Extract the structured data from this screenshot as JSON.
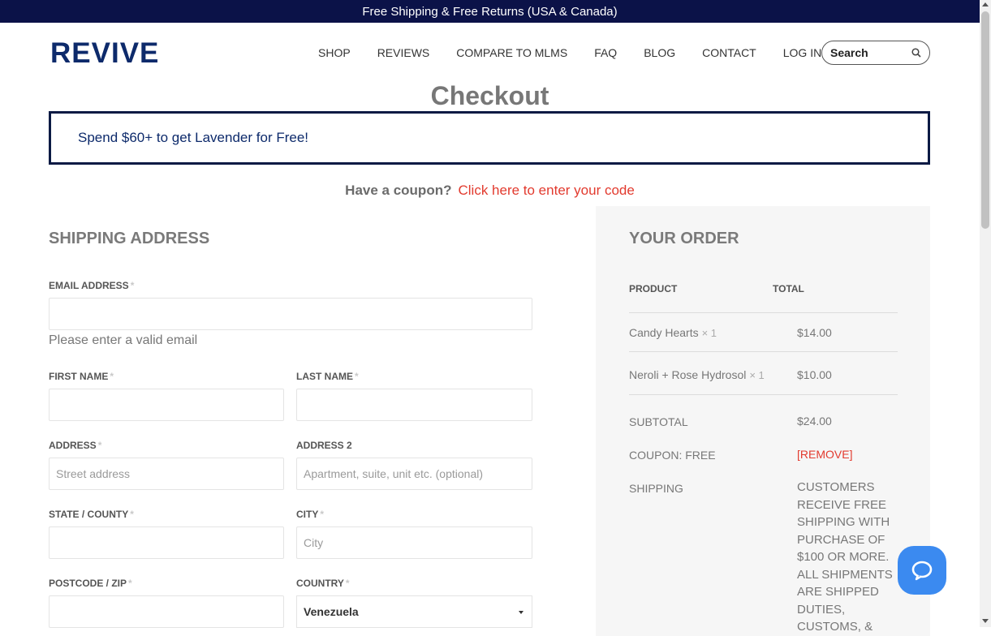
{
  "topbar": {
    "text": "Free Shipping & Free Returns (USA & Canada)"
  },
  "header": {
    "logo": "REVIVE",
    "nav": [
      "SHOP",
      "REVIEWS",
      "COMPARE TO MLMS",
      "FAQ",
      "BLOG",
      "CONTACT",
      "LOG IN"
    ],
    "search_placeholder": "Search"
  },
  "page": {
    "title": "Checkout"
  },
  "promo": {
    "text": "Spend $60+ to get Lavender for Free!"
  },
  "coupon": {
    "question": "Have a coupon?",
    "link": "Click here to enter your code"
  },
  "shipping": {
    "title": "SHIPPING ADDRESS",
    "required_mark": "*",
    "email_label": "EMAIL ADDRESS",
    "email_error": "Please enter a valid email",
    "first_name_label": "FIRST NAME",
    "last_name_label": "LAST NAME",
    "address_label": "ADDRESS",
    "address_placeholder": "Street address",
    "address2_label": "ADDRESS 2",
    "address2_placeholder": "Apartment, suite, unit etc. (optional)",
    "state_label": "STATE / COUNTY",
    "city_label": "CITY",
    "city_placeholder": "City",
    "postcode_label": "POSTCODE / ZIP",
    "country_label": "COUNTRY",
    "country_value": "Venezuela"
  },
  "order": {
    "title": "YOUR ORDER",
    "col_product": "PRODUCT",
    "col_total": "TOTAL",
    "items": [
      {
        "name": "Candy Hearts",
        "qty": "× 1",
        "total": "$14.00"
      },
      {
        "name": "Neroli + Rose Hydrosol",
        "qty": "× 1",
        "total": "$10.00"
      }
    ],
    "subtotal_label": "SUBTOTAL",
    "subtotal_value": "$24.00",
    "coupon_label": "COUPON: FREE",
    "coupon_remove": "[REMOVE]",
    "shipping_label": "SHIPPING",
    "shipping_text": "CUSTOMERS RECEIVE FREE SHIPPING WITH PURCHASE OF $100 OR MORE. ALL SHIPMENTS ARE SHIPPED DUTIES, CUSTOMS, &"
  },
  "colors": {
    "navy": "#0b1248",
    "accent_red": "#e23a2e",
    "chat_blue": "#3b8af0"
  }
}
